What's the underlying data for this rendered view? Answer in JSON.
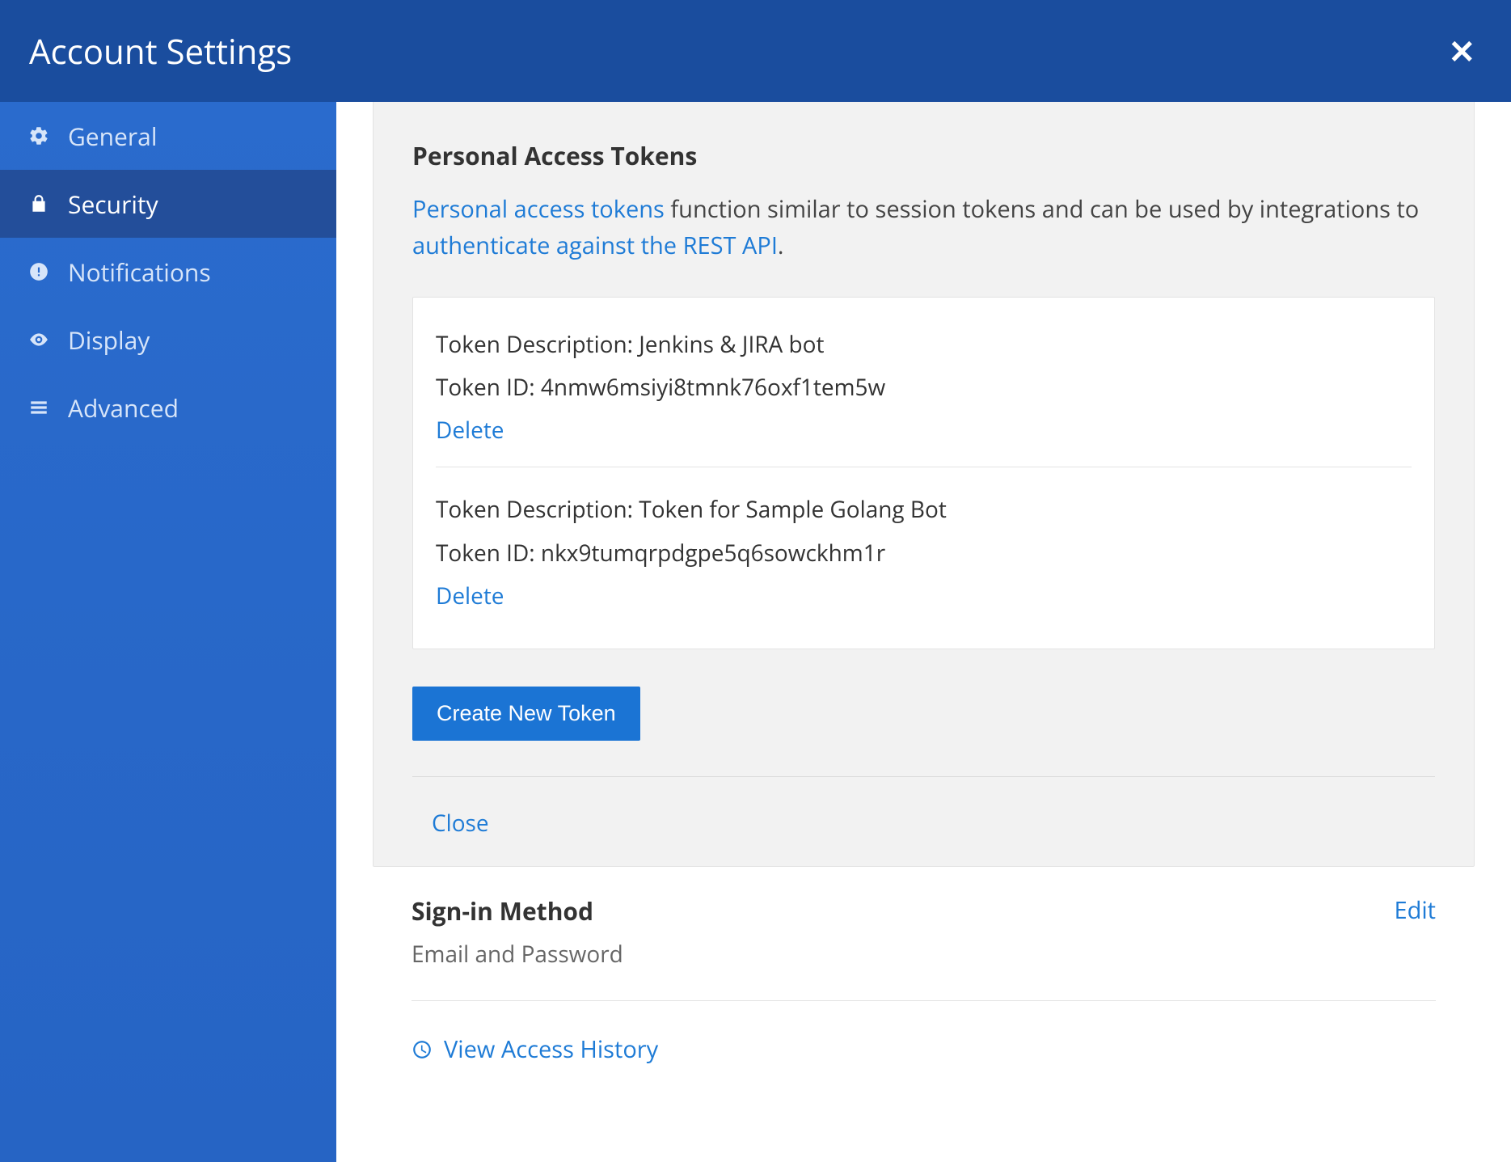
{
  "header": {
    "title": "Account Settings"
  },
  "sidebar": {
    "items": [
      {
        "label": "General"
      },
      {
        "label": "Security"
      },
      {
        "label": "Notifications"
      },
      {
        "label": "Display"
      },
      {
        "label": "Advanced"
      }
    ]
  },
  "pat": {
    "section_title": "Personal Access Tokens",
    "desc_link1": "Personal access tokens",
    "desc_middle": " function similar to session tokens and can be used by integrations to ",
    "desc_link2": "authenticate against the REST API",
    "desc_end": ".",
    "label_description": "Token Description: ",
    "label_id": "Token ID: ",
    "delete_label": "Delete",
    "tokens": [
      {
        "description": "Jenkins & JIRA bot",
        "id": "4nmw6msiyi8tmnk76oxf1tem5w"
      },
      {
        "description": "Token for Sample Golang Bot",
        "id": "nkx9tumqrpdgpe5q6sowckhm1r"
      }
    ],
    "create_button": "Create New Token",
    "close_label": "Close"
  },
  "signin": {
    "title": "Sign-in Method",
    "method": "Email and Password",
    "edit_label": "Edit"
  },
  "history": {
    "label": "View Access History"
  }
}
